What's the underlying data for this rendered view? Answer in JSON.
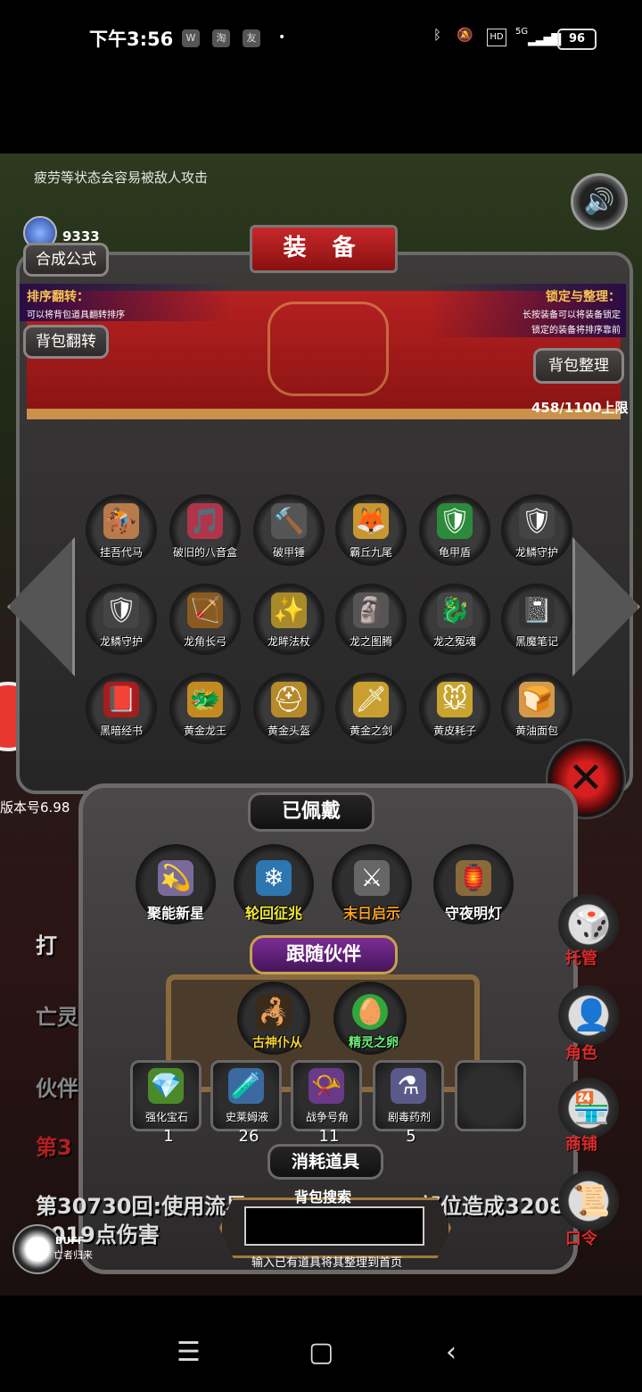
{
  "status": {
    "time": "下午3:56",
    "apps": [
      "W",
      "淘",
      "友"
    ],
    "network": "5G",
    "battery": "96"
  },
  "game": {
    "tip": "疲劳等状态会容易被敌人攻击",
    "gem_count": "9333",
    "version": "版本号6.98",
    "buff_title": "BUFF",
    "buff_name": "亡者归来"
  },
  "equip": {
    "title": "装 备",
    "formula_button": "合成公式",
    "sort_title": "排序翻转：",
    "sort_desc": "可以将背包道具翻转排序",
    "flip_button": "背包翻转",
    "lock_title": "锁定与整理：",
    "lock_desc1": "长按装备可以将装备锁定",
    "lock_desc2": "锁定的装备将排序靠前",
    "organize_button": "背包整理",
    "capacity": "458/1100上限",
    "items": [
      {
        "name": "挂吾代马"
      },
      {
        "name": "破旧的八音盒"
      },
      {
        "name": "破甲锤"
      },
      {
        "name": "霸丘九尾"
      },
      {
        "name": "龟甲盾"
      },
      {
        "name": "龙鳞守护"
      },
      {
        "name": "龙鳞守护"
      },
      {
        "name": "龙角长弓"
      },
      {
        "name": "龙眸法杖"
      },
      {
        "name": "龙之图腾"
      },
      {
        "name": "龙之冤魂"
      },
      {
        "name": "黑魔笔记"
      },
      {
        "name": "黑暗经书"
      },
      {
        "name": "黄金龙王"
      },
      {
        "name": "黄金头盔"
      },
      {
        "name": "黄金之剑"
      },
      {
        "name": "黄皮耗子"
      },
      {
        "name": "黄油面包"
      }
    ]
  },
  "worn": {
    "title": "已佩戴",
    "items": [
      {
        "name": "聚能新星"
      },
      {
        "name": "轮回征兆"
      },
      {
        "name": "末日启示"
      },
      {
        "name": "守夜明灯"
      }
    ]
  },
  "companion": {
    "title": "跟随伙伴",
    "items": [
      {
        "name": "古神仆从"
      },
      {
        "name": "精灵之卵"
      }
    ]
  },
  "consumables": {
    "title": "消耗道具",
    "items": [
      {
        "name": "强化宝石",
        "count": "1"
      },
      {
        "name": "史莱姆液",
        "count": "26"
      },
      {
        "name": "战争号角",
        "count": "11"
      },
      {
        "name": "剧毒药剂",
        "count": "5"
      }
    ]
  },
  "search": {
    "title": "背包搜索",
    "hint": "输入已有道具将其整理到首页"
  },
  "side": {
    "manage": "托管",
    "role": "角色",
    "shop": "商铺",
    "command": "口令"
  },
  "log": {
    "line1": "打",
    "line2": "亡灵",
    "line3": "伙伴",
    "line4": "第3",
    "line5": "第30730回:使用流星",
    "line5b": "部位造成3208",
    "line6": "2019点伤害"
  },
  "colors": {
    "curtain": "#b72121",
    "accent": "#f6c454",
    "side_label": "#d92a2a"
  }
}
